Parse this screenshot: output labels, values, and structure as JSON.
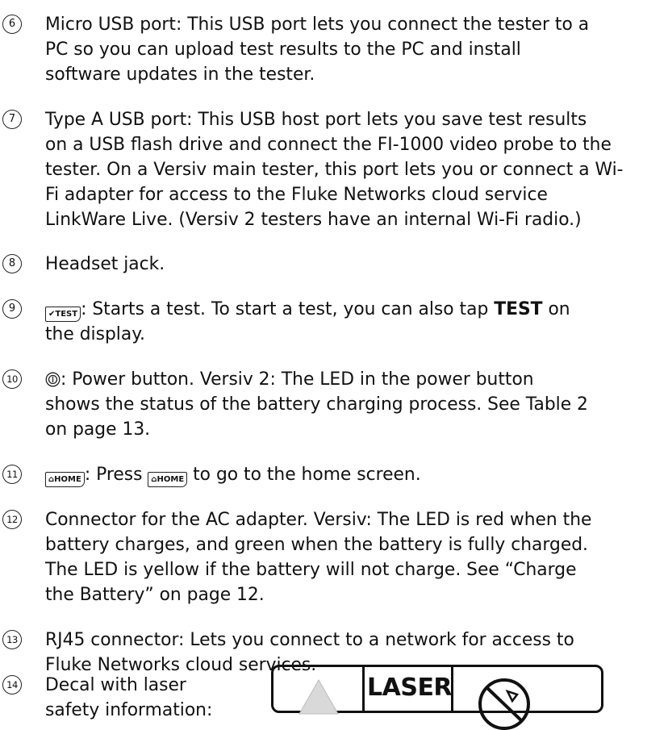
{
  "items": [
    {
      "number": "6",
      "lines": [
        "Micro USB port: This USB port lets you connect the tester to a",
        "PC so you can upload test results to the PC and install",
        "software updates in the tester."
      ]
    },
    {
      "number": "7",
      "lines": [
        "Type A USB port: This USB host port lets you save test results",
        "on a USB flash drive and connect the FI-1000 video probe to the",
        "tester. On a Versiv main tester, this port lets you or connect a Wi-",
        "Fi adapter for access to the Fluke Networks cloud service",
        "LinkWare Live. (Versiv 2 testers have an internal Wi-Fi radio.)"
      ]
    },
    {
      "number": "8",
      "lines": [
        "Headset jack."
      ]
    },
    {
      "number": "9",
      "key": "✔TEST",
      "line1_rest": ": Starts a test. To start a test, you can also tap ",
      "bold": "TEST",
      "line1_end": " on",
      "line2": "the display."
    },
    {
      "number": "10",
      "line1_rest": ": Power button. Versiv 2: The LED in the power button",
      "line2": "shows the status of the battery charging process. See Table 2",
      "line3": "on page 13."
    },
    {
      "number": "11",
      "key": "⌂HOME",
      "mid": ": Press ",
      "end": " to go to the home screen."
    },
    {
      "number": "12",
      "lines": [
        "Connector for the AC adapter. Versiv: The LED is red when the",
        "battery charges, and green when the battery is fully charged.",
        "The LED is yellow if the battery will not charge. See “Charge",
        "the Battery” on page 12."
      ]
    },
    {
      "number": "13",
      "lines": [
        "RJ45 connector: Lets you connect to a network for access to",
        "Fluke Networks cloud services."
      ]
    },
    {
      "number": "14",
      "lines": [
        "Decal with laser",
        "safety information:"
      ]
    }
  ],
  "decal": {
    "laser_text": "LASER"
  }
}
